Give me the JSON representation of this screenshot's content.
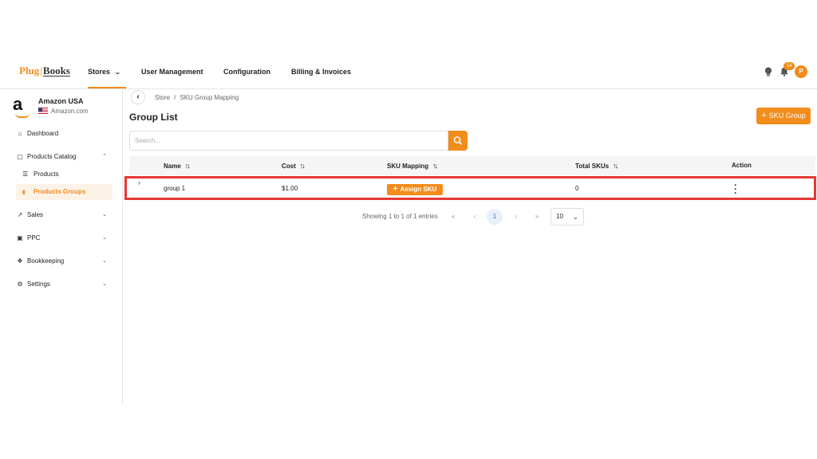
{
  "app": {
    "logo_part1": "Plug",
    "logo_part2": "Books"
  },
  "topnav": {
    "items": [
      {
        "label": "Stores"
      },
      {
        "label": "User Management"
      },
      {
        "label": "Configuration"
      },
      {
        "label": "Billing & Invoices"
      }
    ],
    "notifications_count": "14",
    "avatar_initial": "P"
  },
  "store": {
    "name": "Amazon USA",
    "marketplace": "Amazon.com"
  },
  "sidebar": {
    "dashboard": "Dashboard",
    "products_catalog": "Products Catalog",
    "products": "Products",
    "products_groups": "Products Groups",
    "sales": "Sales",
    "ppc": "PPC",
    "bookkeeping": "Bookkeeping",
    "settings": "Settings"
  },
  "breadcrumb": {
    "root": "Store",
    "current": "SKU Group Mapping"
  },
  "page": {
    "title": "Group List",
    "add_button": "SKU Group",
    "search_placeholder": "Search..."
  },
  "table": {
    "headers": {
      "name": "Name",
      "cost": "Cost",
      "sku_mapping": "SKU Mapping",
      "total_skus": "Total SKUs",
      "action": "Action"
    },
    "rows": [
      {
        "name": "group 1",
        "cost": "$1.00",
        "sku_button": "Assign SKU",
        "total_skus": "0"
      }
    ]
  },
  "pagination": {
    "info": "Showing 1 to 1 of 1 entries",
    "current_page": "1",
    "page_size": "10"
  },
  "colors": {
    "accent": "#f28c1b",
    "highlight_border": "#e53935"
  }
}
